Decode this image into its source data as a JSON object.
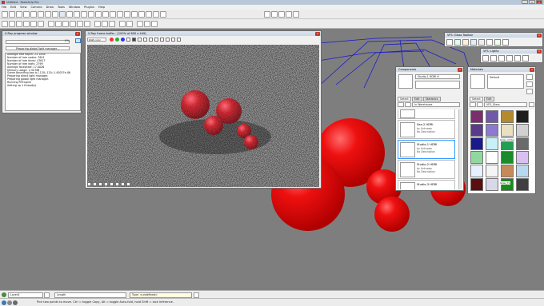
{
  "app": {
    "title": "Untitled - SketchUp Pro"
  },
  "menu": [
    "File",
    "Edit",
    "View",
    "Camera",
    "Draw",
    "Tools",
    "Window",
    "Plugins",
    "Help"
  ],
  "legend_ticks": [
    "0.0",
    "0.2",
    "0.4",
    "0.6",
    "0.8",
    "1.0",
    "2.0"
  ],
  "progress": {
    "title": "V-Ray progress window",
    "percent": "0%",
    "percent_value": 0,
    "status": "Preparing global light manager...",
    "log": [
      "Average tree depth: 23.1858",
      "Number of tree nodes: 7641",
      "Number of tree faces: 47617",
      "Number of tree leafs: 2799",
      "Average faces/leaf: 17.0026",
      "Memory usage: 2.30 MB",
      "Scene bounding box is [-120;-120;-1.45037e-06",
      "Preparing direct light manager.",
      "Preparing global light manager.",
      "Running RTEngine",
      "Setting up 1 thread(s)"
    ]
  },
  "framebuffer": {
    "title": "V-Ray frame buffer - [100% of 600 x 449]",
    "channel": "RGB color"
  },
  "vfb_toolbars": {
    "glass": "VFS: Glass Toolbar",
    "lights": "VFS: Lights"
  },
  "components": {
    "title": "Components",
    "preview_name": "Studio-1 HDRI H",
    "tabs": [
      "Select",
      "Edit",
      "Statistics"
    ],
    "location": "In Warehouse",
    "items": [
      {
        "name": "Sea-2 HDRI",
        "by": "by Unknown",
        "desc": "No Description"
      },
      {
        "name": "Studio-1 HDRI",
        "by": "by Unknown",
        "desc": "No Description"
      },
      {
        "name": "Studio-2 HDRI",
        "by": "by Unknown",
        "desc": "No Description"
      },
      {
        "name": "Studio-3 HDRI",
        "by": "by Unknown",
        "desc": "No Description"
      }
    ]
  },
  "materials": {
    "title": "Materials",
    "default_name": "Default",
    "tabs": [
      "Select",
      "Edit"
    ],
    "library": "VFS_Glass",
    "labels": {
      "glass_amber": "Glass_Amber",
      "glass_tin": "Glass_Tin"
    },
    "swatch_colors": [
      "#7a2e6e",
      "#6f5aa8",
      "#b48a2c",
      "#1e1e1e",
      "#5a3a8a",
      "#8c7ad0",
      "#e8e0c0",
      "#d0d0d0",
      "#1a1a8a",
      "#c8f0f8",
      "#20a050",
      "#6a6a6a",
      "#90d8a0",
      "#ffffff",
      "#1a8a2a",
      "#d8c0f0",
      "#e6f0ff",
      "#f5f5f5",
      "#c48a5a",
      "#b8d8f0",
      "#5a1010",
      "#d8d8e8",
      "#1a8a1a",
      "#404040"
    ]
  },
  "status": {
    "layer": "Layer0",
    "length_label": "Length",
    "type_value": "Type: <undefined>",
    "hint": "Pick two points to move.  Ctrl = toggle Copy, Alt = toggle Auto-fold, hold Shift = lock inference."
  }
}
